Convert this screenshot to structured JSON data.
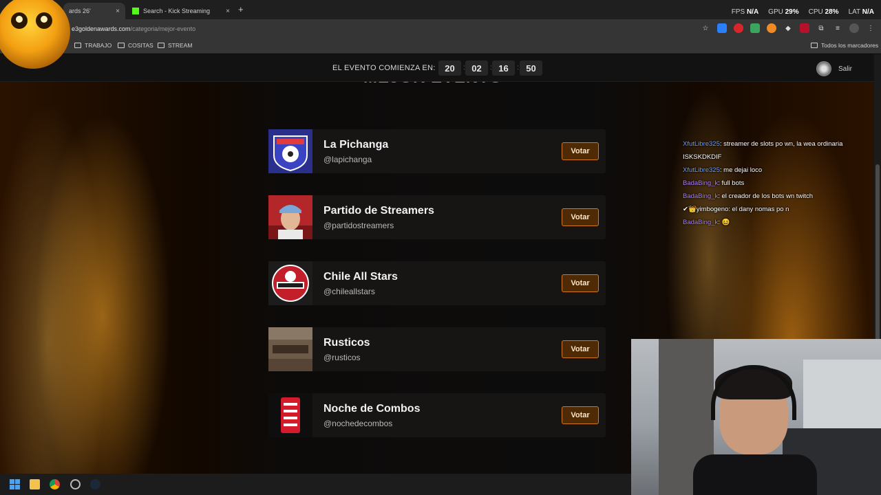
{
  "browser": {
    "tabs": [
      {
        "title": "ards 26'",
        "active": true
      },
      {
        "title": "Search - Kick Streaming",
        "active": false
      }
    ],
    "new_tab": "+",
    "close_glyph": "×",
    "url_host": "e3goldenawards.com",
    "url_path": "/categoria/mejor-evento",
    "bookmarks": [
      "TRABAJO",
      "COSITAS",
      "STREAM"
    ],
    "all_bookmarks": "Todos los marcadores"
  },
  "overlay_stats": {
    "fps_label": "FPS",
    "fps_value": "N/A",
    "gpu_label": "GPU",
    "gpu_value": "29%",
    "cpu_label": "CPU",
    "cpu_value": "28%",
    "lat_label": "LAT",
    "lat_value": "N/A"
  },
  "countdown": {
    "label": "EL EVENTO COMIENZA EN:",
    "days": "20",
    "hours": "02",
    "minutes": "16",
    "seconds": "50",
    "separator": ":"
  },
  "header": {
    "logout_label": "Salir"
  },
  "section": {
    "title": "MEJOR EVENTO"
  },
  "vote_label": "Votar",
  "nominees": [
    {
      "name": "La Pichanga",
      "handle": "@lapichanga",
      "logo": "lapichanga-logo"
    },
    {
      "name": "Partido de Streamers",
      "handle": "@partidostreamers",
      "logo": "partido-streamers-photo"
    },
    {
      "name": "Chile All Stars",
      "handle": "@chileallstars",
      "logo": "chile-all-stars-logo"
    },
    {
      "name": "Rusticos",
      "handle": "@rusticos",
      "logo": "rusticos-logo"
    },
    {
      "name": "Noche de Combos",
      "handle": "@nochedecombos",
      "logo": "noche-de-combos-logo"
    }
  ],
  "chat": [
    {
      "user": "XfutLibre325",
      "message": " streamer de slots po wn, la wea ordinaria ISKSKDKDIF",
      "color": "#6aa0ff"
    },
    {
      "user": "XfutLibre325",
      "message": " me dejai loco",
      "color": "#6aa0ff"
    },
    {
      "user": "BadaBing_k",
      "message": " full bots",
      "color": "#b37dff"
    },
    {
      "user": "BadaBing_k",
      "message": " el creador de los bots wn twitch",
      "color": "#b37dff"
    },
    {
      "user": "✔👑yimbogeno",
      "message": " el dany nomas po n",
      "color": "#ffffff"
    },
    {
      "user": "BadaBing_k",
      "message": " 😆",
      "color": "#b37dff"
    }
  ],
  "colors": {
    "accent": "#f0891b",
    "vote_border": "#d3791a",
    "vote_bg": "#4e2a05"
  }
}
